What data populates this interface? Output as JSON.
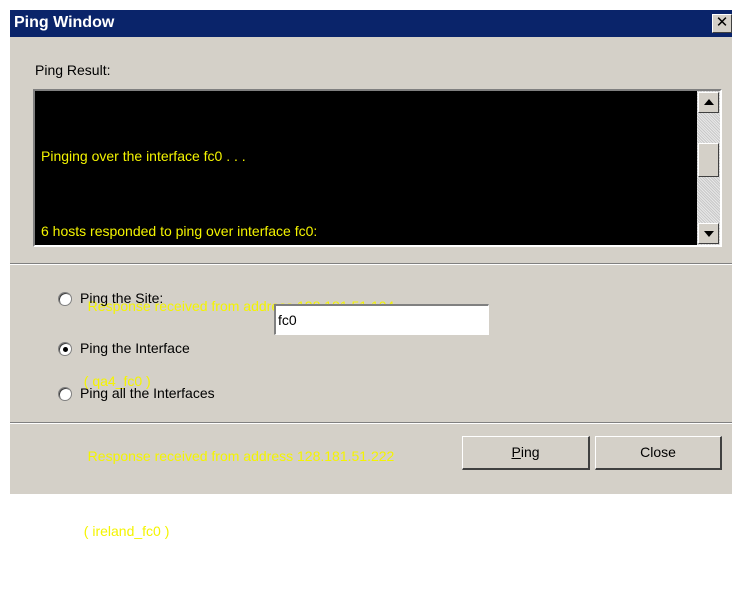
{
  "window": {
    "title": "Ping Window",
    "close_glyph": "✕"
  },
  "result": {
    "label": "Ping Result:",
    "lines": [
      "Pinging over the interface fc0 . . .",
      "6 hosts responded to ping over interface fc0:",
      "            Response received from address 128.181.51.104",
      "           ( qa4_fc0 )",
      "            Response received from address 128.181.51.222",
      "           ( ireland_fc0 )"
    ],
    "text_color": "#f4f400",
    "background": "#000000"
  },
  "options": {
    "site_label": "Ping the Site:",
    "interface_label": "Ping the Interface",
    "all_label": "Ping all the Interfaces",
    "selected": "interface"
  },
  "input": {
    "value": "fc0"
  },
  "buttons": {
    "ping_label": "Ping",
    "ping_mnemonic": "P",
    "ping_rest": "ing",
    "close_label": "Close"
  },
  "colors": {
    "title_bar": "#0a246a",
    "face": "#d4d0c8"
  }
}
